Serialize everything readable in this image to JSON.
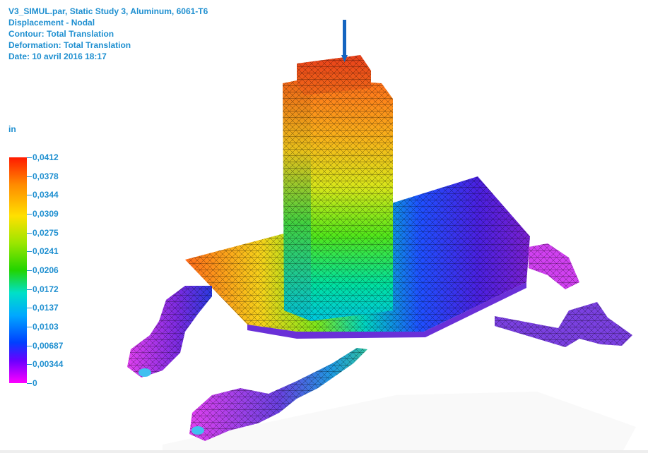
{
  "header": {
    "line1": "V3_SIMUL.par, Static Study 3, Aluminum, 6061-T6",
    "line2": "Displacement - Nodal",
    "line3": "Contour: Total Translation",
    "line4": "Deformation: Total Translation",
    "line5": "Date: 10 avril 2016  18:17"
  },
  "legend": {
    "unit": "in",
    "ticks": [
      "0,0412",
      "0,0378",
      "0,0344",
      "0,0309",
      "0,0275",
      "0,0241",
      "0,0206",
      "0,0172",
      "0,0137",
      "0,0103",
      "0,00687",
      "0,00344",
      "0"
    ]
  },
  "colors": {
    "text": "#1e8fd0",
    "arrow": "#1565c0"
  }
}
